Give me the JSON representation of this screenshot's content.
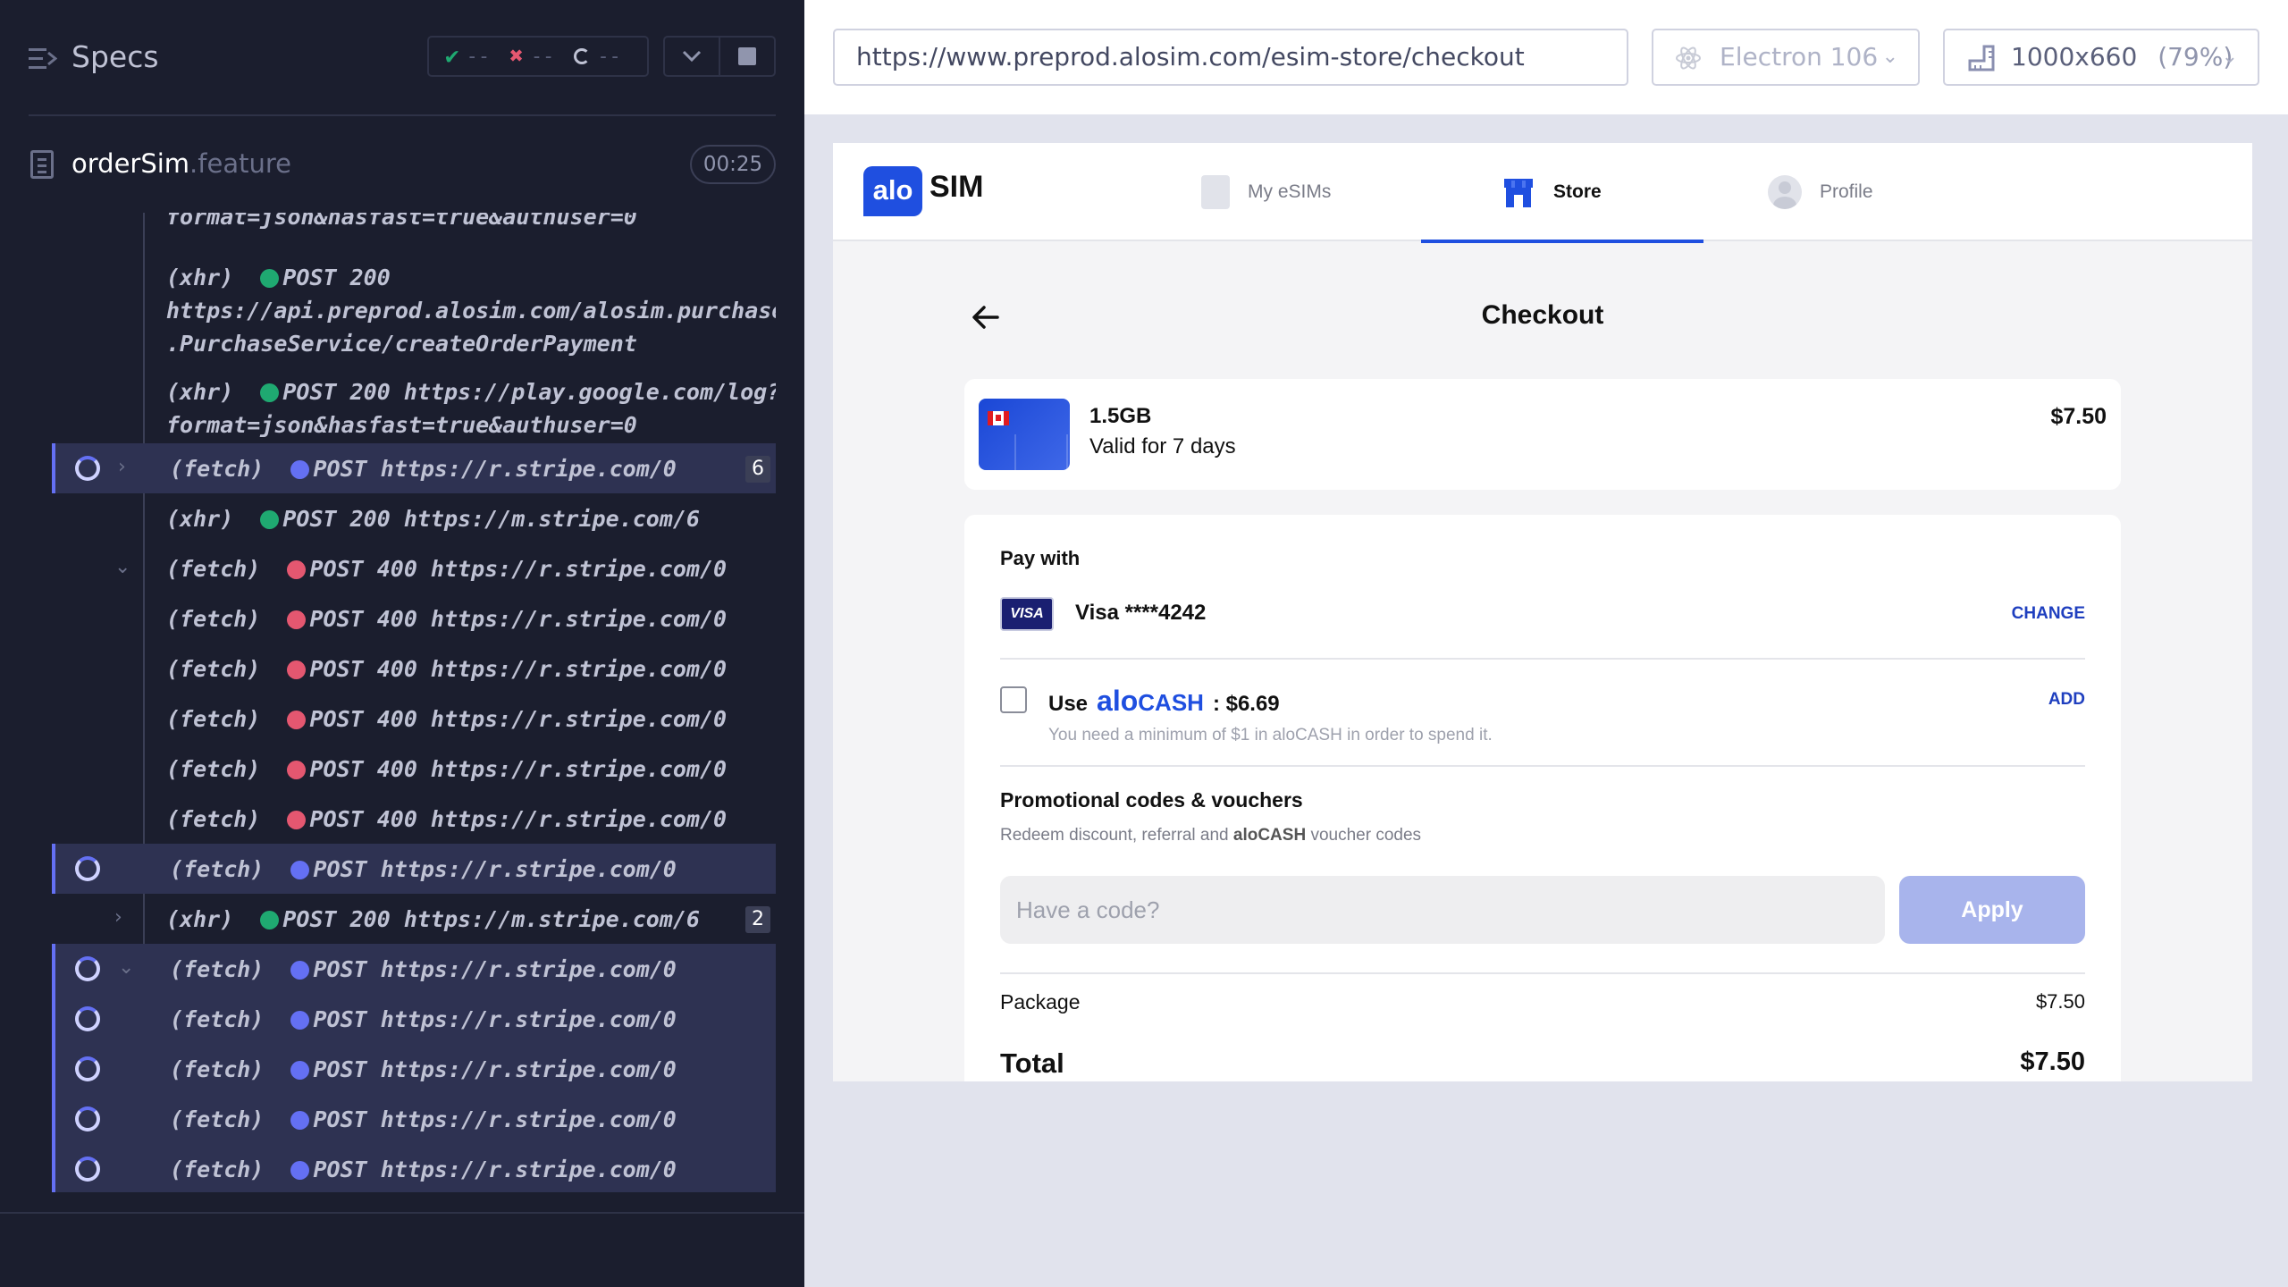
{
  "runner": {
    "title": "Specs",
    "stats": {
      "passed": "--",
      "failed": "--",
      "pending": "--"
    },
    "file": {
      "name": "orderSim",
      "ext": ".feature",
      "duration": "00:25"
    }
  },
  "commands": [
    {
      "type": "",
      "line1": "format=json&hasfast=true&authuser=0",
      "state": "plain"
    },
    {
      "type": "(xhr)",
      "dot": "green",
      "method": "POST 200",
      "line1": "",
      "line2": "https://api.preprod.alosim.com/alosim.purchase",
      "line3": ".PurchaseService/createOrderPayment",
      "state": "plain"
    },
    {
      "type": "(xhr)",
      "dot": "green",
      "method": "POST 200 https://play.google.com/log?",
      "line2": "format=json&hasfast=true&authuser=0",
      "state": "plain"
    },
    {
      "type": "(fetch)",
      "dot": "purple",
      "method": "POST https://r.stripe.com/0",
      "state": "pending",
      "chev": "›",
      "count": "6"
    },
    {
      "type": "(xhr)",
      "dot": "green",
      "method": "POST 200 https://m.stripe.com/6",
      "state": "plain"
    },
    {
      "type": "(fetch)",
      "dot": "red",
      "method": "POST 400 https://r.stripe.com/0",
      "state": "plain",
      "chev": "⌄"
    },
    {
      "type": "(fetch)",
      "dot": "red",
      "method": "POST 400 https://r.stripe.com/0",
      "state": "plain"
    },
    {
      "type": "(fetch)",
      "dot": "red",
      "method": "POST 400 https://r.stripe.com/0",
      "state": "plain"
    },
    {
      "type": "(fetch)",
      "dot": "red",
      "method": "POST 400 https://r.stripe.com/0",
      "state": "plain"
    },
    {
      "type": "(fetch)",
      "dot": "red",
      "method": "POST 400 https://r.stripe.com/0",
      "state": "plain"
    },
    {
      "type": "(fetch)",
      "dot": "red",
      "method": "POST 400 https://r.stripe.com/0",
      "state": "plain"
    },
    {
      "type": "(fetch)",
      "dot": "purple",
      "method": "POST https://r.stripe.com/0",
      "state": "pending"
    },
    {
      "type": "(xhr)",
      "dot": "green",
      "method": "POST 200 https://m.stripe.com/6",
      "state": "plain",
      "chev": "›",
      "count": "2"
    },
    {
      "type": "(fetch)",
      "dot": "purple",
      "method": "POST https://r.stripe.com/0",
      "state": "pending",
      "chev": "⌄"
    },
    {
      "type": "(fetch)",
      "dot": "purple",
      "method": "POST https://r.stripe.com/0",
      "state": "pending"
    },
    {
      "type": "(fetch)",
      "dot": "purple",
      "method": "POST https://r.stripe.com/0",
      "state": "pending"
    },
    {
      "type": "(fetch)",
      "dot": "purple",
      "method": "POST https://r.stripe.com/0",
      "state": "pending"
    },
    {
      "type": "(fetch)",
      "dot": "purple",
      "method": "POST https://r.stripe.com/0",
      "state": "pending"
    }
  ],
  "browser": {
    "url": "https://www.preprod.alosim.com/esim-store/checkout",
    "name": "Electron 106",
    "viewport": "1000x660",
    "zoom": "(79%)"
  },
  "app": {
    "logo_badge": "alo",
    "logo_text": "SIM",
    "nav": {
      "esims": "My eSIMs",
      "store": "Store",
      "profile": "Profile"
    },
    "title": "Checkout",
    "plan": {
      "data": "1.5GB",
      "validity": "Valid for 7 days",
      "price": "$7.50"
    },
    "payment": {
      "heading": "Pay with",
      "card_brand": "VISA",
      "card_text": "Visa ****4242",
      "change": "CHANGE",
      "use_label": "Use",
      "alocash_a": "alo",
      "alocash_b": "CASH",
      "balance": ": $6.69",
      "add": "ADD",
      "min_note": "You need a minimum of $1 in aloCASH in order to spend it."
    },
    "promo": {
      "title": "Promotional codes & vouchers",
      "sub_a": "Redeem discount, referral and ",
      "sub_b": "aloCASH",
      "sub_c": " voucher codes",
      "placeholder": "Have a code?",
      "apply": "Apply"
    },
    "summary": {
      "package_label": "Package",
      "package_value": "$7.50",
      "total_label": "Total",
      "total_value": "$7.50"
    }
  },
  "colors": {
    "accent": "#1f4fe0",
    "runner_bg": "#1b1e2e",
    "pending": "#6470f3",
    "pass": "#1fa971",
    "fail": "#e45770"
  }
}
